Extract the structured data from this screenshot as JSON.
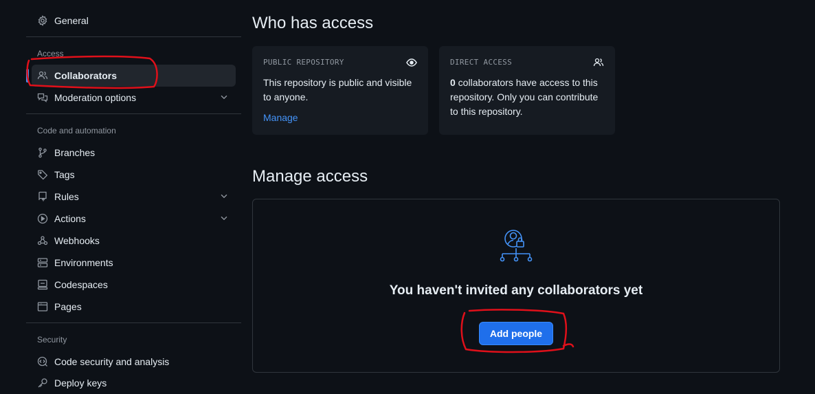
{
  "sidebar": {
    "general": "General",
    "access_heading": "Access",
    "collaborators": "Collaborators",
    "moderation": "Moderation options",
    "code_heading": "Code and automation",
    "branches": "Branches",
    "tags": "Tags",
    "rules": "Rules",
    "actions": "Actions",
    "webhooks": "Webhooks",
    "environments": "Environments",
    "codespaces": "Codespaces",
    "pages": "Pages",
    "security_heading": "Security",
    "code_security": "Code security and analysis",
    "deploy_keys": "Deploy keys"
  },
  "who_has_access": {
    "title": "Who has access",
    "public_card": {
      "title": "PUBLIC REPOSITORY",
      "body": "This repository is public and visible to anyone.",
      "link": "Manage"
    },
    "direct_card": {
      "title": "DIRECT ACCESS",
      "count": "0",
      "body": " collaborators have access to this repository. Only you can contribute to this repository."
    }
  },
  "manage_access": {
    "title": "Manage access",
    "empty_text": "You haven't invited any collaborators yet",
    "add_button": "Add people"
  },
  "colors": {
    "background": "#0d1117",
    "accent": "#4493f8",
    "primary_button": "#1f6feb",
    "annotation": "#e0101a"
  },
  "icons": {
    "general": "gear-icon",
    "collaborators": "people-icon",
    "moderation": "comment-discussion-icon",
    "branches": "git-branch-icon",
    "tags": "tag-icon",
    "rules": "repo-push-icon",
    "actions": "play-icon",
    "webhooks": "webhook-icon",
    "environments": "server-icon",
    "codespaces": "codespaces-icon",
    "pages": "browser-icon",
    "code_security": "codescan-icon",
    "deploy_keys": "key-icon",
    "public_repo": "eye-icon",
    "direct_access": "people-icon",
    "empty_state": "collaborators-lock-icon"
  }
}
